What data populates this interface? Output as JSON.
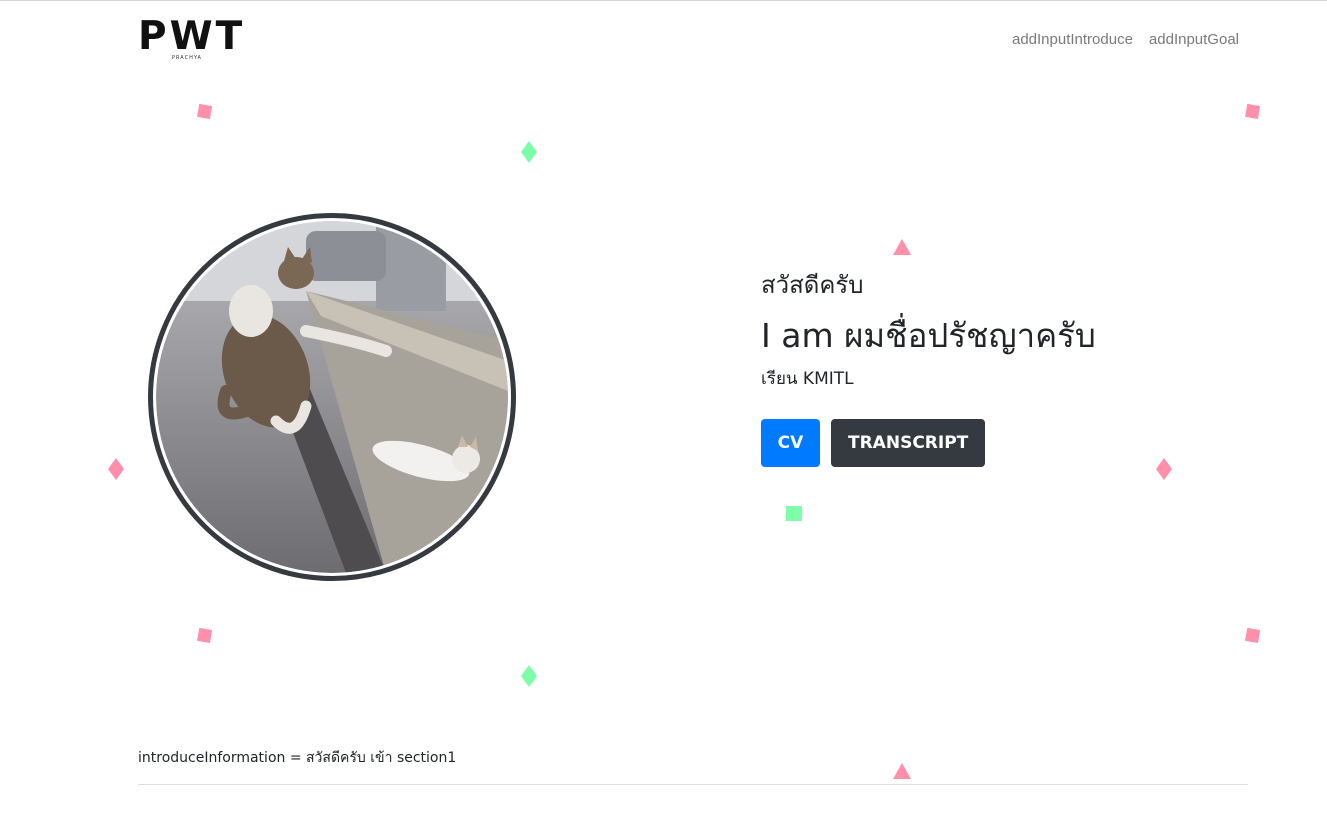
{
  "header": {
    "logo_text": "PWT",
    "logo_sub": "PRACHYA",
    "nav": [
      {
        "label": "addInputIntroduce"
      },
      {
        "label": "addInputGoal"
      }
    ]
  },
  "hero": {
    "greeting": "สวัสดีครับ",
    "name": "I am ผมชื่อปรัชญาครับ",
    "school": "เรียน KMITL",
    "buttons": {
      "cv_label": "CV",
      "transcript_label": "TRANSCRIPT"
    }
  },
  "footer": {
    "info": "introduceInformation = สวัสดีครับ เข้า section1"
  },
  "colors": {
    "primary": "#007bff",
    "dark": "#343a40",
    "confetti_pink": "#ff8fab",
    "confetti_green": "#7dffa8"
  }
}
